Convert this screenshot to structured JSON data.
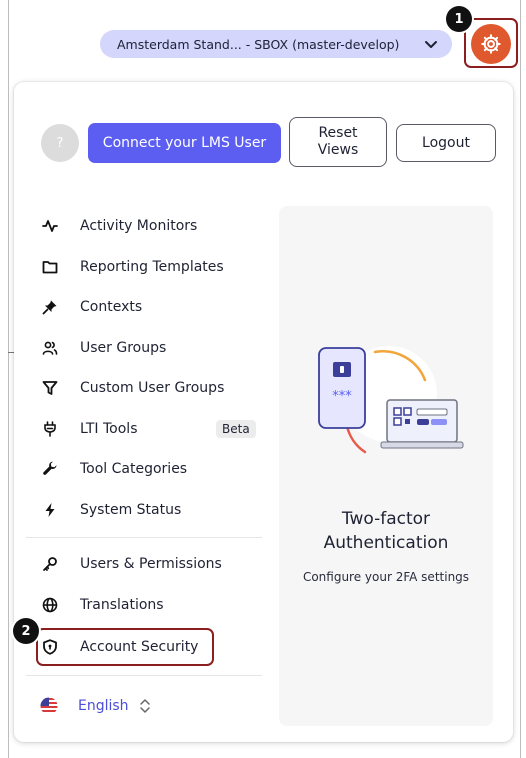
{
  "environment": {
    "label": "Amsterdam Stand... - SBOX (master-develop)"
  },
  "header": {
    "settings_icon": "gear-icon",
    "accent_color": "#e0582d",
    "highlight_color": "#8b1e1e"
  },
  "steps": {
    "one": "1",
    "two": "2"
  },
  "user": {
    "avatar_text": "?",
    "connect_label": "Connect your LMS User",
    "reset_label": "Reset Views",
    "logout_label": "Logout"
  },
  "menu": {
    "items": [
      {
        "label": "Activity Monitors",
        "icon": "activity-icon"
      },
      {
        "label": "Reporting Templates",
        "icon": "folder-icon"
      },
      {
        "label": "Contexts",
        "icon": "pin-icon"
      },
      {
        "label": "User Groups",
        "icon": "users-icon"
      },
      {
        "label": "Custom User Groups",
        "icon": "filter-icon"
      },
      {
        "label": "LTI Tools",
        "icon": "plug-icon",
        "badge": "Beta"
      },
      {
        "label": "Tool Categories",
        "icon": "wrench-icon"
      },
      {
        "label": "System Status",
        "icon": "lightning-icon"
      },
      {
        "label": "Users & Permissions",
        "icon": "key-icon"
      },
      {
        "label": "Translations",
        "icon": "globe-icon"
      },
      {
        "label": "Account Security",
        "icon": "shield-icon"
      }
    ]
  },
  "language": {
    "label": "English",
    "flag": "us-flag-icon"
  },
  "promo": {
    "title_line1": "Two-factor",
    "title_line2": "Authentication",
    "subtitle": "Configure your 2FA settings",
    "code_text": "***"
  }
}
